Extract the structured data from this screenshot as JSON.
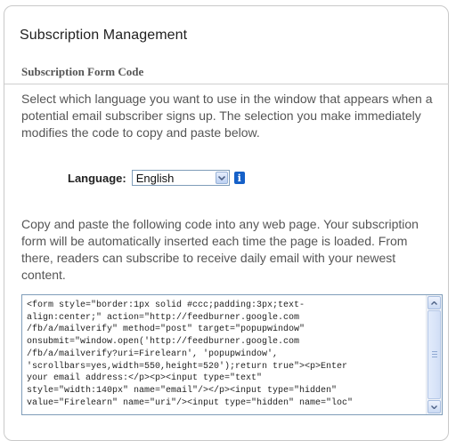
{
  "panel": {
    "title": "Subscription Management",
    "section_title": "Subscription Form Code"
  },
  "intro": {
    "text": "Select which language you want to use in the window that appears when a potential email subscriber signs up. The selection you make immediately modifies the code to copy and paste below."
  },
  "language": {
    "label": "Language:",
    "selected": "English",
    "arrow_icon": "chevron-down-icon",
    "info_icon": "info-icon"
  },
  "instructions": {
    "text": "Copy and paste the following code into any web page. Your subscription form will be automatically inserted each time the page is loaded. From there, readers can subscribe to receive daily email with your newest content."
  },
  "code_box": {
    "code": "<form style=\"border:1px solid #ccc;padding:3px;text-\nalign:center;\" action=\"http://feedburner.google.com\n/fb/a/mailverify\" method=\"post\" target=\"popupwindow\"\nonsubmit=\"window.open('http://feedburner.google.com\n/fb/a/mailverify?uri=Firelearn', 'popupwindow',\n'scrollbars=yes,width=550,height=520');return true\"><p>Enter\nyour email address:</p><p><input type=\"text\"\nstyle=\"width:140px\" name=\"email\"/></p><input type=\"hidden\"\nvalue=\"Firelearn\" name=\"uri\"/><input type=\"hidden\" name=\"loc\""
  },
  "colors": {
    "border": "#c9c9c9",
    "text": "#555555",
    "info_icon": "#1560c8",
    "input_border": "#7f9db9"
  }
}
